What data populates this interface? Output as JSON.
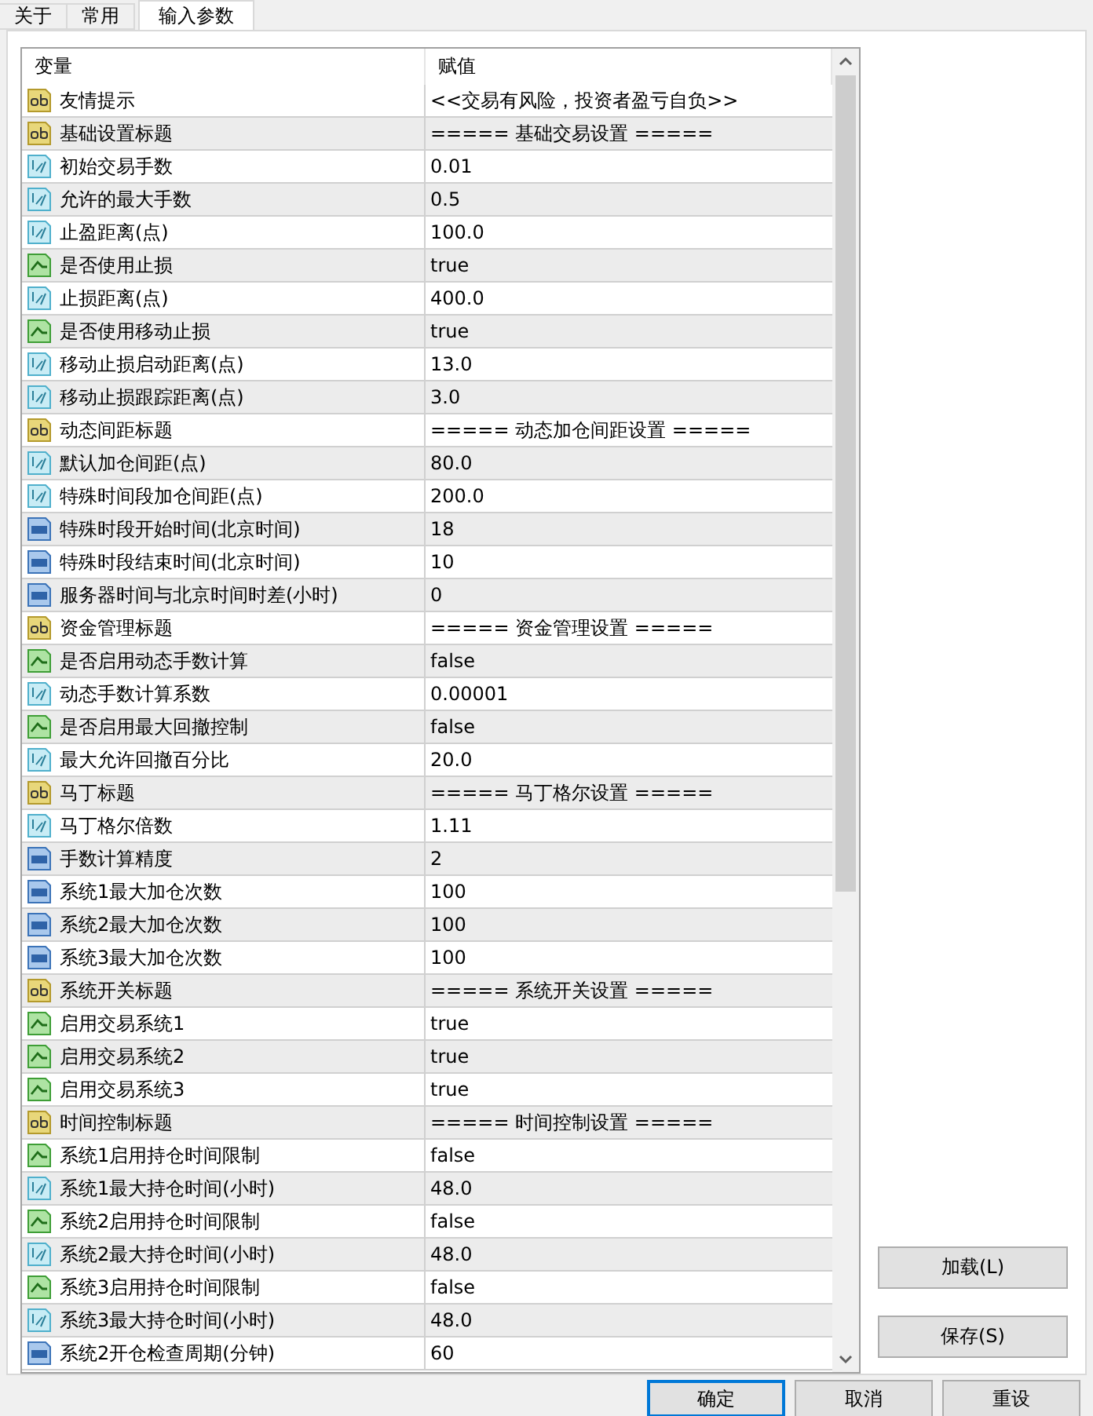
{
  "tabs": [
    {
      "label": "关于",
      "selected": false
    },
    {
      "label": "常用",
      "selected": false
    },
    {
      "label": "输入参数",
      "selected": true
    }
  ],
  "table": {
    "columns": [
      "变量",
      "赋值"
    ],
    "rows": [
      {
        "kind": "string",
        "name": "友情提示",
        "value": "<<交易有风险，投资者盈亏自负>>"
      },
      {
        "kind": "string",
        "name": "基础设置标题",
        "value": "===== 基础交易设置 ====="
      },
      {
        "kind": "double",
        "name": "初始交易手数",
        "value": "0.01"
      },
      {
        "kind": "double",
        "name": "允许的最大手数",
        "value": "0.5"
      },
      {
        "kind": "double",
        "name": "止盈距离(点)",
        "value": "100.0"
      },
      {
        "kind": "bool",
        "name": "是否使用止损",
        "value": "true"
      },
      {
        "kind": "double",
        "name": "止损距离(点)",
        "value": "400.0"
      },
      {
        "kind": "bool",
        "name": "是否使用移动止损",
        "value": "true"
      },
      {
        "kind": "double",
        "name": "移动止损启动距离(点)",
        "value": "13.0"
      },
      {
        "kind": "double",
        "name": "移动止损跟踪距离(点)",
        "value": "3.0"
      },
      {
        "kind": "string",
        "name": "动态间距标题",
        "value": "===== 动态加仓间距设置 ====="
      },
      {
        "kind": "double",
        "name": "默认加仓间距(点)",
        "value": "80.0"
      },
      {
        "kind": "double",
        "name": "特殊时间段加仓间距(点)",
        "value": "200.0"
      },
      {
        "kind": "int",
        "name": "特殊时段开始时间(北京时间)",
        "value": "18"
      },
      {
        "kind": "int",
        "name": "特殊时段结束时间(北京时间)",
        "value": "10"
      },
      {
        "kind": "int",
        "name": "服务器时间与北京时间时差(小时)",
        "value": "0"
      },
      {
        "kind": "string",
        "name": "资金管理标题",
        "value": "===== 资金管理设置 ====="
      },
      {
        "kind": "bool",
        "name": "是否启用动态手数计算",
        "value": "false"
      },
      {
        "kind": "double",
        "name": "动态手数计算系数",
        "value": "0.00001"
      },
      {
        "kind": "bool",
        "name": "是否启用最大回撤控制",
        "value": "false"
      },
      {
        "kind": "double",
        "name": "最大允许回撤百分比",
        "value": "20.0"
      },
      {
        "kind": "string",
        "name": "马丁标题",
        "value": "===== 马丁格尔设置 ====="
      },
      {
        "kind": "double",
        "name": "马丁格尔倍数",
        "value": "1.11"
      },
      {
        "kind": "int",
        "name": "手数计算精度",
        "value": "2"
      },
      {
        "kind": "int",
        "name": "系统1最大加仓次数",
        "value": "100"
      },
      {
        "kind": "int",
        "name": "系统2最大加仓次数",
        "value": "100"
      },
      {
        "kind": "int",
        "name": "系统3最大加仓次数",
        "value": "100"
      },
      {
        "kind": "string",
        "name": "系统开关标题",
        "value": "===== 系统开关设置 ====="
      },
      {
        "kind": "bool",
        "name": "启用交易系统1",
        "value": "true"
      },
      {
        "kind": "bool",
        "name": "启用交易系统2",
        "value": "true"
      },
      {
        "kind": "bool",
        "name": "启用交易系统3",
        "value": "true"
      },
      {
        "kind": "string",
        "name": "时间控制标题",
        "value": "===== 时间控制设置 ====="
      },
      {
        "kind": "bool",
        "name": "系统1启用持仓时间限制",
        "value": "false"
      },
      {
        "kind": "double",
        "name": "系统1最大持仓时间(小时)",
        "value": "48.0"
      },
      {
        "kind": "bool",
        "name": "系统2启用持仓时间限制",
        "value": "false"
      },
      {
        "kind": "double",
        "name": "系统2最大持仓时间(小时)",
        "value": "48.0"
      },
      {
        "kind": "bool",
        "name": "系统3启用持仓时间限制",
        "value": "false"
      },
      {
        "kind": "double",
        "name": "系统3最大持仓时间(小时)",
        "value": "48.0"
      },
      {
        "kind": "int",
        "name": "系统2开仓检查周期(分钟)",
        "value": "60"
      }
    ]
  },
  "side_buttons": [
    "加载(L)",
    "保存(S)"
  ],
  "buttons": [
    {
      "label": "确定",
      "focused": true
    },
    {
      "label": "取消",
      "focused": false
    },
    {
      "label": "重设",
      "focused": false
    }
  ]
}
